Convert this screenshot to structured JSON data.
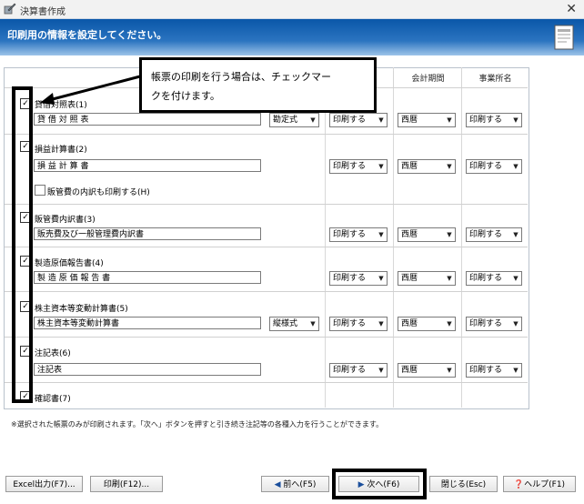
{
  "window": {
    "title": "決算書作成",
    "close_glyph": "✕"
  },
  "header": {
    "instruction": "印刷用の情報を設定してください。"
  },
  "callout": {
    "line1": "帳票の印刷を行う場合は、チェックマー",
    "line2": "クを付けます。"
  },
  "columns": {
    "period": "会計期間",
    "office": "事業所名"
  },
  "rows": [
    {
      "check": "✓",
      "label": "貸借対照表(1)",
      "name": "貸 借 対 照 表",
      "format": "勘定式",
      "print": "印刷する",
      "era": "西暦",
      "office": "印刷する"
    },
    {
      "check": "✓",
      "label": "損益計算書(2)",
      "name": "損 益 計 算 書",
      "print": "印刷する",
      "era": "西暦",
      "office": "印刷する",
      "sub_label": "販管費の内訳も印刷する(H)"
    },
    {
      "check": "✓",
      "label": "販管費内訳書(3)",
      "name": "販売費及び一般管理費内訳書",
      "print": "印刷する",
      "era": "西暦",
      "office": "印刷する"
    },
    {
      "check": "✓",
      "label": "製造原価報告書(4)",
      "name": "製 造 原 価 報 告 書",
      "print": "印刷する",
      "era": "西暦",
      "office": "印刷する"
    },
    {
      "check": "✓",
      "label": "株主資本等変動計算書(5)",
      "name": "株主資本等変動計算書",
      "format": "縦様式",
      "print": "印刷する",
      "era": "西暦",
      "office": "印刷する"
    },
    {
      "check": "✓",
      "label": "注記表(6)",
      "name": "注記表",
      "print": "印刷する",
      "era": "西暦",
      "office": "印刷する"
    },
    {
      "check": "✓",
      "label": "確認書(7)"
    }
  ],
  "note": "※選択された帳票のみが印刷されます。「次へ」ボタンを押すと引き続き注記等の各種入力を行うことができます。",
  "buttons": {
    "excel": "Excel出力(F7)...",
    "print": "印刷(F12)...",
    "prev": "前へ(F5)",
    "next": "次へ(F6)",
    "close": "閉じる(Esc)",
    "help": "ヘルプ(F1)"
  },
  "colors": {
    "header_blue": "#0a57a8",
    "highlight": "#000000"
  }
}
